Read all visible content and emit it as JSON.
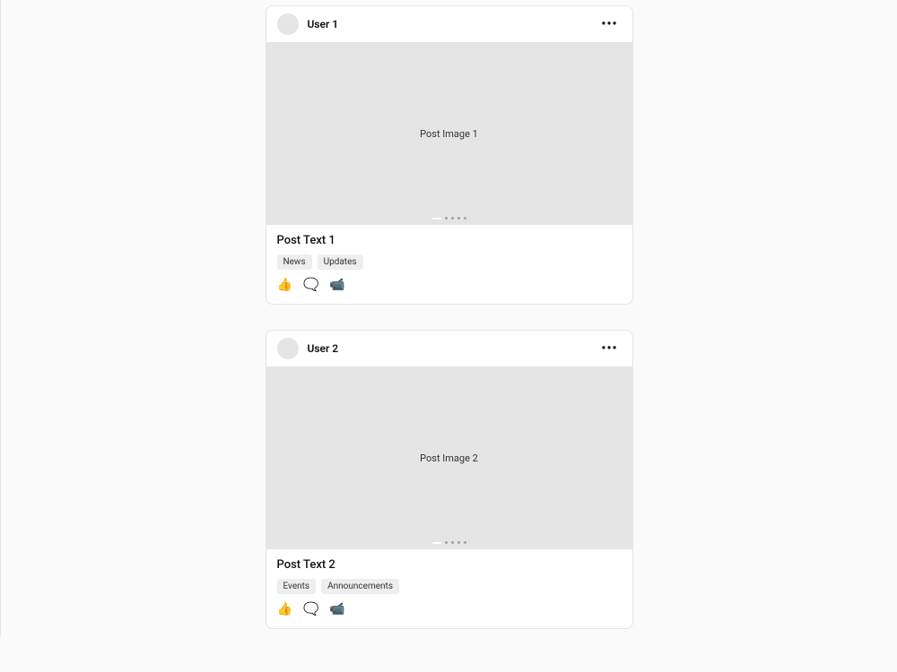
{
  "posts": [
    {
      "user": "User 1",
      "image_label": "Post Image 1",
      "text": "Post Text 1",
      "tags": [
        "News",
        "Updates"
      ],
      "actions": {
        "like": "👍",
        "comment": "🗨️",
        "share": "📹"
      }
    },
    {
      "user": "User 2",
      "image_label": "Post Image 2",
      "text": "Post Text 2",
      "tags": [
        "Events",
        "Announcements"
      ],
      "actions": {
        "like": "👍",
        "comment": "🗨️",
        "share": "📹"
      }
    }
  ]
}
